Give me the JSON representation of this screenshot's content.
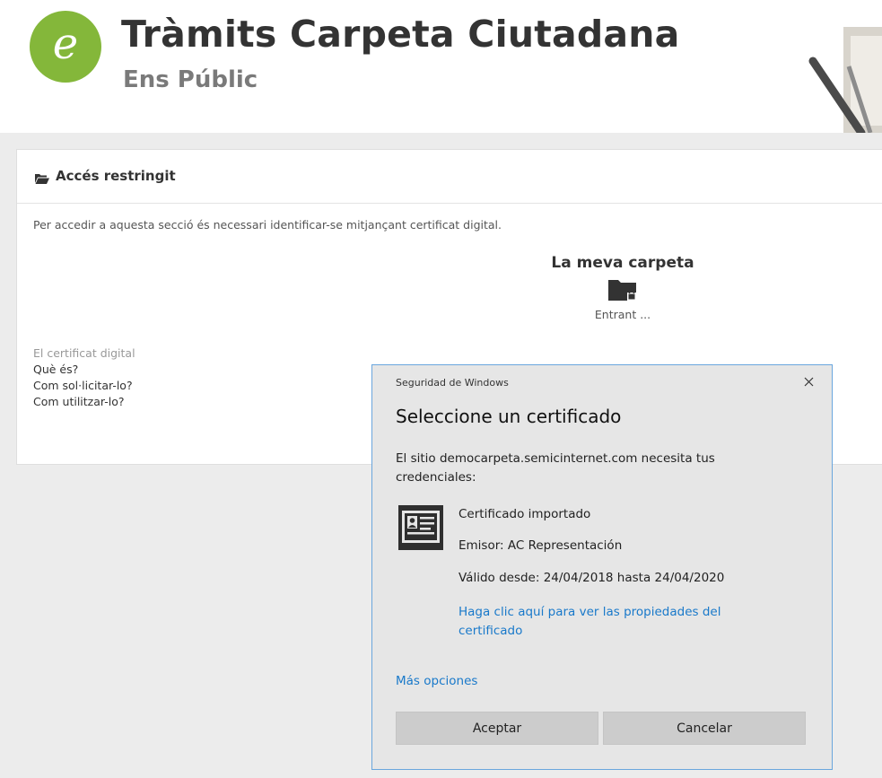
{
  "header": {
    "logo_letter": "e",
    "title": "Tràmits Carpeta Ciutadana",
    "subtitle": "Ens Públic"
  },
  "panel": {
    "title": "Accés restringit",
    "intro": "Per accedir a aquesta secció és necessari identificar-se mitjançant certificat digital.",
    "carpeta_title": "La meva carpeta",
    "carpeta_status": "Entrant ...",
    "cert_heading": "El certificat digital",
    "links": [
      "Què és?",
      "Com sol·licitar-lo?",
      "Com utilitzar-lo?"
    ]
  },
  "dialog": {
    "caption": "Seguridad de Windows",
    "heading": "Seleccione un certificado",
    "message": "El sitio democarpeta.semicinternet.com necesita tus credenciales:",
    "certificate": {
      "name": "Certificado importado",
      "issuer": "Emisor: AC Representación",
      "validity": "Válido desde: 24/04/2018 hasta 24/04/2020"
    },
    "properties_link": "Haga clic aquí para ver las propiedades del certificado",
    "more_options": "Más opciones",
    "accept_label": "Aceptar",
    "cancel_label": "Cancelar"
  },
  "colors": {
    "brand_green": "#84b73a",
    "link_blue": "#1979ca",
    "dialog_border": "#6aa6dd"
  }
}
